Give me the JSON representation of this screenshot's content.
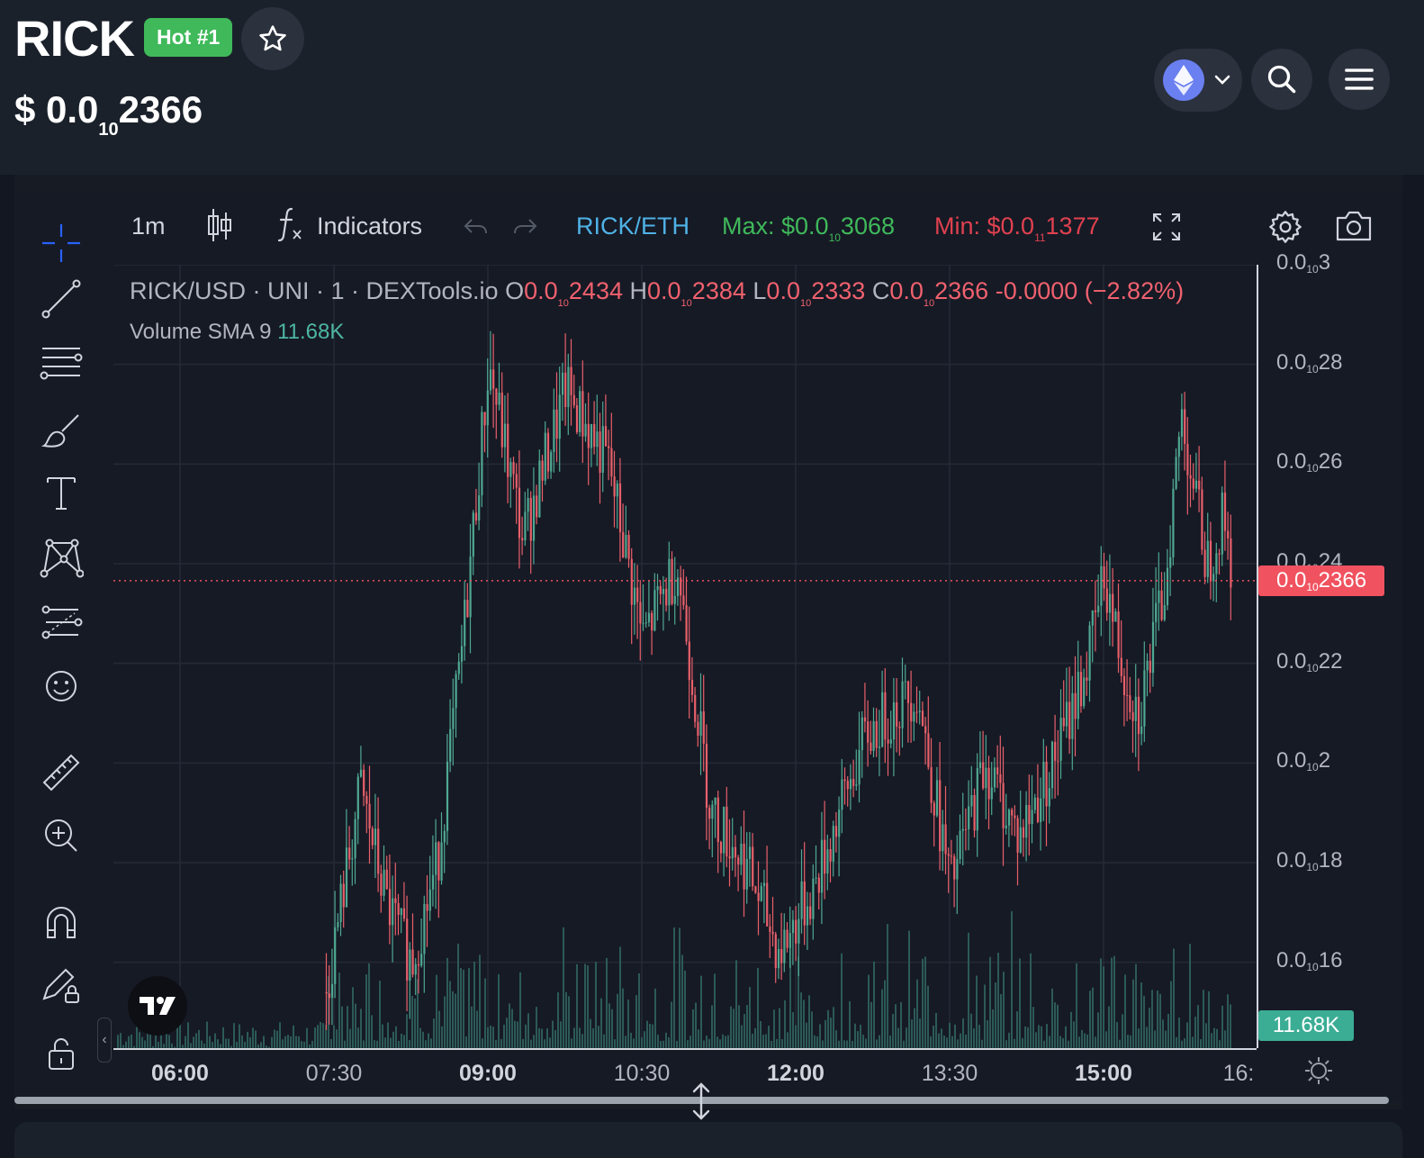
{
  "header": {
    "token_symbol": "RICK",
    "hot_badge": "Hot #1",
    "price_prefix": "$ 0.0",
    "price_sub": "10",
    "price_tail": "2366",
    "search_icon": "search-icon",
    "menu_icon": "hamburger-menu-icon",
    "chain_icon": "ethereum-icon"
  },
  "toolbar": {
    "interval": "1m",
    "indicators_label": "Indicators",
    "pair_label": "RICK/ETH",
    "max_prefix": "Max: $0.0",
    "max_sub": "10",
    "max_tail": "3068",
    "min_prefix": "Min: $0.0",
    "min_sub": "11",
    "min_tail": "1377",
    "colors": {
      "pair": "#4fb2e6",
      "max": "#3fb95a",
      "min": "#e0414f"
    }
  },
  "legend": {
    "symbol_line": "RICK/USD · UNI · 1 · DEXTools.io",
    "o_label": "O",
    "o_prefix": "0.0",
    "o_sub": "10",
    "o_tail": "2434",
    "h_label": "H",
    "h_prefix": "0.0",
    "h_sub": "10",
    "h_tail": "2384",
    "l_label": "L",
    "l_prefix": "0.0",
    "l_sub": "10",
    "l_tail": "2333",
    "c_label": "C",
    "c_prefix": "0.0",
    "c_sub": "10",
    "c_tail": "2366",
    "change": "-0.0000 (−2.82%)",
    "volume_label": "Volume SMA 9",
    "volume_value": "11.68K"
  },
  "y_axis": {
    "labels": [
      {
        "prefix": "0.0",
        "sub": "10",
        "tail": "3"
      },
      {
        "prefix": "0.0",
        "sub": "10",
        "tail": "28"
      },
      {
        "prefix": "0.0",
        "sub": "10",
        "tail": "26"
      },
      {
        "prefix": "0.0",
        "sub": "10",
        "tail": "24"
      },
      {
        "prefix": "0.0",
        "sub": "10",
        "tail": "22"
      },
      {
        "prefix": "0.0",
        "sub": "10",
        "tail": "2"
      },
      {
        "prefix": "0.0",
        "sub": "10",
        "tail": "18"
      },
      {
        "prefix": "0.0",
        "sub": "10",
        "tail": "16"
      }
    ],
    "current_price": {
      "prefix": "0.0",
      "sub": "10",
      "tail": "2366"
    },
    "volume_tag": "11.68K"
  },
  "x_axis": {
    "labels": [
      {
        "text": "06:00",
        "bold": true
      },
      {
        "text": "07:30",
        "bold": false
      },
      {
        "text": "09:00",
        "bold": true
      },
      {
        "text": "10:30",
        "bold": false
      },
      {
        "text": "12:00",
        "bold": true
      },
      {
        "text": "13:30",
        "bold": false
      },
      {
        "text": "15:00",
        "bold": true
      },
      {
        "text": "16:",
        "bold": false
      }
    ]
  },
  "left_tools": [
    "crosshair-icon",
    "trend-line-icon",
    "fib-retracement-icon",
    "brush-icon",
    "text-icon",
    "pattern-icon",
    "prediction-icon",
    "emoji-icon",
    "ruler-icon",
    "zoom-in-icon",
    "magnet-icon",
    "lock-drawing-icon",
    "unlock-icon"
  ],
  "chart_data": {
    "type": "candlestick",
    "title": "RICK/USD · UNI · 1 · DEXTools.io",
    "xlabel": "",
    "ylabel": "",
    "x_ticks": [
      "06:00",
      "07:30",
      "09:00",
      "10:30",
      "12:00",
      "13:30",
      "15:00",
      "16:"
    ],
    "y_ticks_e10": [
      1.6,
      1.8,
      2.0,
      2.2,
      2.4,
      2.6,
      2.8,
      3.0
    ],
    "ylim_e10": [
      1.5,
      3.0
    ],
    "current_price_e10": 2.366,
    "ohlc_last": {
      "open": "0.0₁₀2434",
      "high": "0.0₁₀2384",
      "low": "0.0₁₀2333",
      "close": "0.0₁₀2366"
    },
    "price_path_e10": [
      {
        "t": "07:25",
        "v": 1.54
      },
      {
        "t": "07:45",
        "v": 1.95
      },
      {
        "t": "08:00",
        "v": 1.72
      },
      {
        "t": "08:15",
        "v": 1.6
      },
      {
        "t": "08:30",
        "v": 1.8
      },
      {
        "t": "08:45",
        "v": 2.25
      },
      {
        "t": "09:00",
        "v": 2.8
      },
      {
        "t": "09:20",
        "v": 2.45
      },
      {
        "t": "09:45",
        "v": 2.75
      },
      {
        "t": "10:10",
        "v": 2.6
      },
      {
        "t": "10:30",
        "v": 2.25
      },
      {
        "t": "10:50",
        "v": 2.4
      },
      {
        "t": "11:10",
        "v": 1.9
      },
      {
        "t": "11:30",
        "v": 1.8
      },
      {
        "t": "11:50",
        "v": 1.62
      },
      {
        "t": "12:10",
        "v": 1.75
      },
      {
        "t": "12:40",
        "v": 2.05
      },
      {
        "t": "13:10",
        "v": 2.15
      },
      {
        "t": "13:30",
        "v": 1.75
      },
      {
        "t": "13:50",
        "v": 2.0
      },
      {
        "t": "14:10",
        "v": 1.85
      },
      {
        "t": "14:30",
        "v": 2.0
      },
      {
        "t": "14:50",
        "v": 2.2
      },
      {
        "t": "15:00",
        "v": 2.38
      },
      {
        "t": "15:10",
        "v": 2.2
      },
      {
        "t": "15:20",
        "v": 2.1
      },
      {
        "t": "15:35",
        "v": 2.35
      },
      {
        "t": "15:45",
        "v": 2.7
      },
      {
        "t": "16:00",
        "v": 2.4
      },
      {
        "t": "16:10",
        "v": 2.5
      },
      {
        "t": "16:15",
        "v": 2.366
      }
    ],
    "volume_sma": "11.68K",
    "colors": {
      "up": "#4fa892",
      "down": "#e8606a",
      "volume": "#2c5a57"
    }
  }
}
